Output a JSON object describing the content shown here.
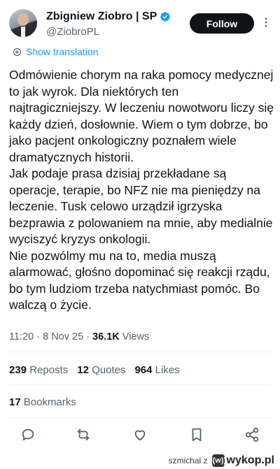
{
  "author": {
    "name": "Zbigniew Ziobro | SP",
    "handle": "@ZiobroPL",
    "verified_color": "#1d9bf0"
  },
  "header": {
    "follow_label": "Follow"
  },
  "translate_label": "Show translation",
  "tweet": {
    "text": "Odmówienie chorym na raka pomocy medycznej to jak wyrok. Dla niektórych ten najtragiczniejszy. W leczeniu nowotworu liczy się każdy dzień, dosłownie. Wiem o tym dobrze, bo jako pacjent onkologiczny poznałem wiele dramatycznych historii.\nJak podaje prasa dzisiaj przekładane są operacje, terapie, bo NFZ nie ma pieniędzy na leczenie. Tusk celowo urządził igrzyska bezprawia z polowaniem na mnie, aby medialnie wyciszyć kryzys onkologii.\nNie pozwólmy mu na to, media muszą alarmować, głośno dopominać się reakcji rządu, bo tym ludziom trzeba natychmiast pomóc. Bo walczą o życie.",
    "time": "11:20",
    "date": "8 Nov 25",
    "views_count": "36.1K",
    "views_label": "Views"
  },
  "stats": {
    "reposts_count": "239",
    "reposts_label": "Reposts",
    "quotes_count": "12",
    "quotes_label": "Quotes",
    "likes_count": "964",
    "likes_label": "Likes",
    "bookmarks_count": "17",
    "bookmarks_label": "Bookmarks"
  },
  "actions": [
    "reply-icon",
    "repost-icon",
    "like-icon",
    "bookmark-icon",
    "share-icon"
  ],
  "watermark": {
    "user": "szmichal",
    "sep": "z",
    "site": "wykop.pl"
  }
}
